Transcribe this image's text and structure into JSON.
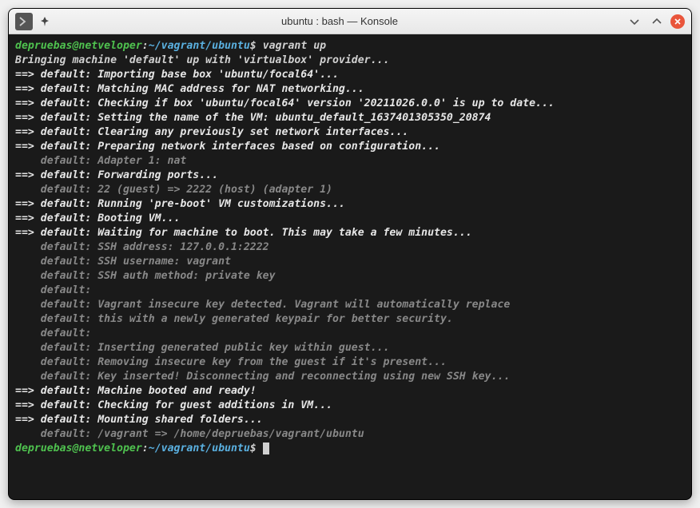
{
  "window": {
    "title": "ubuntu : bash — Konsole"
  },
  "prompt": {
    "user_host": "depruebas@netveloper",
    "separator": ":",
    "path": "~/vagrant/ubuntu",
    "symbol": "$"
  },
  "command": "vagrant up",
  "lines": [
    {
      "type": "plain",
      "text": "Bringing machine 'default' up with 'virtualbox' provider..."
    },
    {
      "type": "step",
      "text": "==> default: Importing base box 'ubuntu/focal64'..."
    },
    {
      "type": "step",
      "text": "==> default: Matching MAC address for NAT networking..."
    },
    {
      "type": "step",
      "text": "==> default: Checking if box 'ubuntu/focal64' version '20211026.0.0' is up to date..."
    },
    {
      "type": "step",
      "text": "==> default: Setting the name of the VM: ubuntu_default_1637401305350_20874"
    },
    {
      "type": "step",
      "text": "==> default: Clearing any previously set network interfaces..."
    },
    {
      "type": "step",
      "text": "==> default: Preparing network interfaces based on configuration..."
    },
    {
      "type": "sub",
      "text": "    default: Adapter 1: nat"
    },
    {
      "type": "step",
      "text": "==> default: Forwarding ports..."
    },
    {
      "type": "sub",
      "text": "    default: 22 (guest) => 2222 (host) (adapter 1)"
    },
    {
      "type": "step",
      "text": "==> default: Running 'pre-boot' VM customizations..."
    },
    {
      "type": "step",
      "text": "==> default: Booting VM..."
    },
    {
      "type": "step",
      "text": "==> default: Waiting for machine to boot. This may take a few minutes..."
    },
    {
      "type": "sub",
      "text": "    default: SSH address: 127.0.0.1:2222"
    },
    {
      "type": "sub",
      "text": "    default: SSH username: vagrant"
    },
    {
      "type": "sub",
      "text": "    default: SSH auth method: private key"
    },
    {
      "type": "sub",
      "text": "    default:"
    },
    {
      "type": "sub",
      "text": "    default: Vagrant insecure key detected. Vagrant will automatically replace"
    },
    {
      "type": "sub",
      "text": "    default: this with a newly generated keypair for better security."
    },
    {
      "type": "sub",
      "text": "    default:"
    },
    {
      "type": "sub",
      "text": "    default: Inserting generated public key within guest..."
    },
    {
      "type": "sub",
      "text": "    default: Removing insecure key from the guest if it's present..."
    },
    {
      "type": "sub",
      "text": "    default: Key inserted! Disconnecting and reconnecting using new SSH key..."
    },
    {
      "type": "step",
      "text": "==> default: Machine booted and ready!"
    },
    {
      "type": "step",
      "text": "==> default: Checking for guest additions in VM..."
    },
    {
      "type": "step",
      "text": "==> default: Mounting shared folders..."
    },
    {
      "type": "sub",
      "text": "    default: /vagrant => /home/depruebas/vagrant/ubuntu"
    }
  ]
}
